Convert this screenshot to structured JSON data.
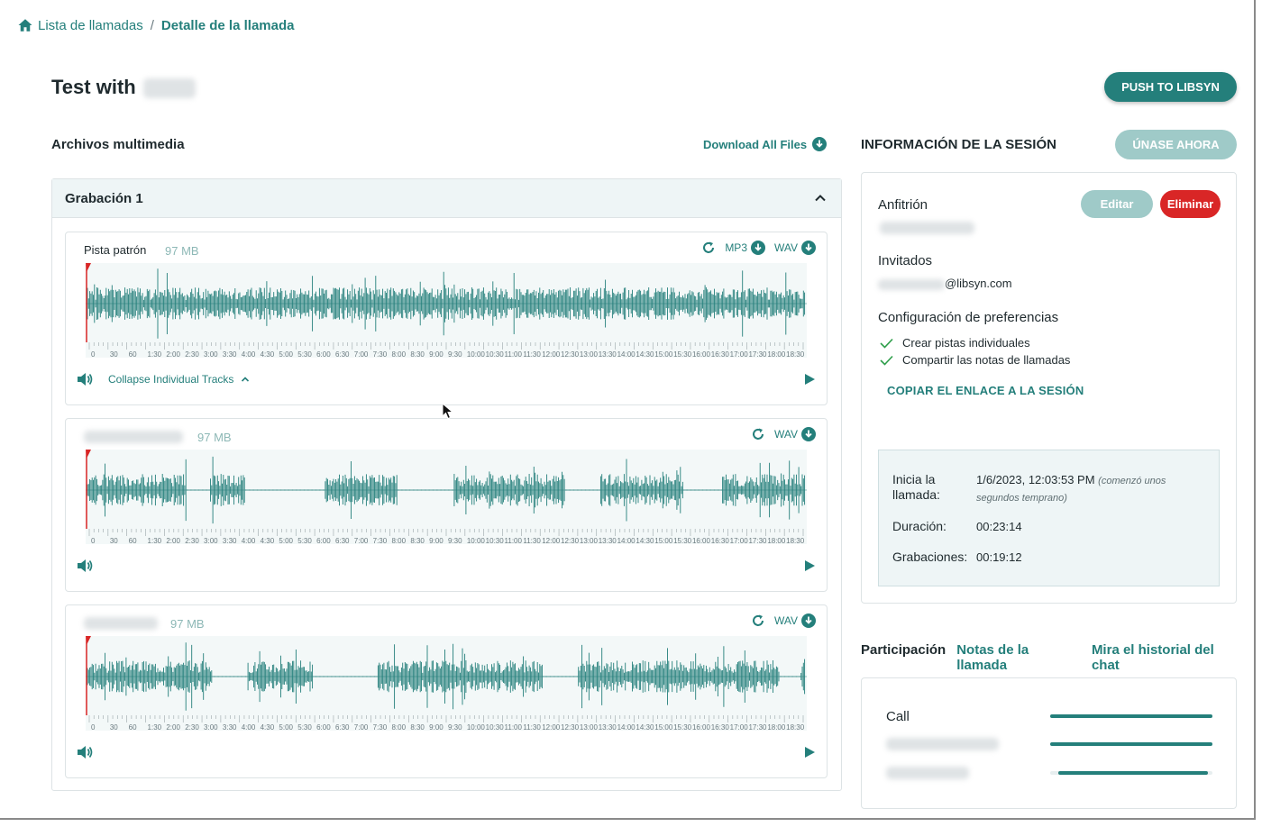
{
  "breadcrumb": {
    "home": "Lista de llamadas",
    "separator": "/",
    "current": "Detalle de la llamada"
  },
  "page": {
    "title": "Test with"
  },
  "header": {
    "push_button": "PUSH TO LIBSYN"
  },
  "media": {
    "section_title": "Archivos multimedia",
    "download_all": "Download All Files",
    "recording_title": "Grabación 1",
    "tracks": [
      {
        "name": "Pista patrón",
        "size": "97 MB",
        "formats": [
          "MP3",
          "WAV"
        ],
        "collapse_label": "Collapse Individual Tracks"
      },
      {
        "name": "",
        "size": "97 MB",
        "formats": [
          "WAV"
        ]
      },
      {
        "name": "",
        "size": "97 MB",
        "formats": [
          "WAV"
        ]
      }
    ],
    "timeline_ticks": [
      "0",
      "30",
      "60",
      "1:30",
      "2:00",
      "2:30",
      "3:00",
      "3:30",
      "4:00",
      "4:30",
      "5:00",
      "5:30",
      "6:00",
      "6:30",
      "7:00",
      "7:30",
      "8:00",
      "8:30",
      "9:00",
      "9:30",
      "10:00",
      "10:30",
      "11:00",
      "11:30",
      "12:00",
      "12:30",
      "13:00",
      "13:30",
      "14:00",
      "14:30",
      "15:00",
      "15:30",
      "16:00",
      "16:30",
      "17:00",
      "17:30",
      "18:00",
      "18:30"
    ]
  },
  "session": {
    "section_title": "INFORMACIÓN DE LA SESIÓN",
    "join_button": "ÚNASE AHORA",
    "host_label": "Anfitrión",
    "edit_button": "Editar",
    "delete_button": "Eliminar",
    "guests_label": "Invitados",
    "guest_email_suffix": "@libsyn.com",
    "prefs_label": "Configuración de preferencias",
    "prefs": [
      "Crear pistas individuales",
      "Compartir las notas de llamadas"
    ],
    "copy_link": "COPIAR EL ENLACE A LA SESIÓN",
    "call_start_label": "Inicia la llamada:",
    "call_start_value": "1/6/2023, 12:03:53 PM",
    "call_start_note": "(comenzó unos segundos temprano)",
    "duration_label": "Duración:",
    "duration_value": "00:23:14",
    "recordings_label": "Grabaciones:",
    "recordings_value": "00:19:12"
  },
  "participation": {
    "tabs": [
      "Participación",
      "Notas de la llamada",
      "Mira el historial del chat"
    ],
    "rows": [
      {
        "name": "Call",
        "start": 0.0,
        "end": 1.0
      },
      {
        "name": "",
        "start": 0.0,
        "end": 1.0
      },
      {
        "name": "",
        "start": 0.05,
        "end": 0.97
      }
    ]
  },
  "colors": {
    "accent": "#247f7b",
    "danger": "#d92626",
    "accent_light": "#9fcac8"
  },
  "icons": {
    "home": "home-icon",
    "download": "download-icon",
    "refresh": "refresh-icon",
    "volume": "volume-icon",
    "play": "play-icon",
    "chevron_up": "chevron-up-icon",
    "check": "check-icon"
  }
}
